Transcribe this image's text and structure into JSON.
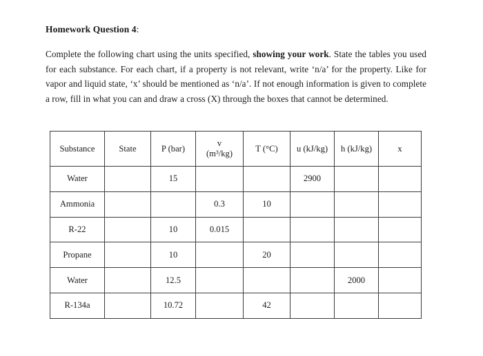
{
  "document": {
    "title_text": "Homework Question 4",
    "title_colon": ":",
    "instructions_part1": "Complete the following chart using the units specified, ",
    "instructions_bold": "showing your work",
    "instructions_part2": ". State the tables you used for each substance. For each chart, if a property is not relevant, write ‘n/a’ for the property. Like for vapor and liquid state, ‘x’ should be mentioned as ‘n/a’. If not enough information is given to complete a row, fill in what you can and draw a cross (X) through the boxes that cannot be determined."
  },
  "table": {
    "headers": [
      {
        "label": "Substance",
        "sub": ""
      },
      {
        "label": "State",
        "sub": ""
      },
      {
        "label": "P (bar)",
        "sub": ""
      },
      {
        "label": "v",
        "sub": "(m³/kg)"
      },
      {
        "label": "T (°C)",
        "sub": ""
      },
      {
        "label": "u (kJ/kg)",
        "sub": ""
      },
      {
        "label": "h (kJ/kg)",
        "sub": ""
      },
      {
        "label": "x",
        "sub": ""
      }
    ],
    "rows": [
      {
        "substance": "Water",
        "state": "",
        "p": "15",
        "v": "",
        "t": "",
        "u": "2900",
        "h": "",
        "x": ""
      },
      {
        "substance": "Ammonia",
        "state": "",
        "p": "",
        "v": "0.3",
        "t": "10",
        "u": "",
        "h": "",
        "x": ""
      },
      {
        "substance": "R-22",
        "state": "",
        "p": "10",
        "v": "0.015",
        "t": "",
        "u": "",
        "h": "",
        "x": ""
      },
      {
        "substance": "Propane",
        "state": "",
        "p": "10",
        "v": "",
        "t": "20",
        "u": "",
        "h": "",
        "x": ""
      },
      {
        "substance": "Water",
        "state": "",
        "p": "12.5",
        "v": "",
        "t": "",
        "u": "",
        "h": "2000",
        "x": ""
      },
      {
        "substance": "R-134a",
        "state": "",
        "p": "10.72",
        "v": "",
        "t": "42",
        "u": "",
        "h": "",
        "x": ""
      }
    ]
  }
}
